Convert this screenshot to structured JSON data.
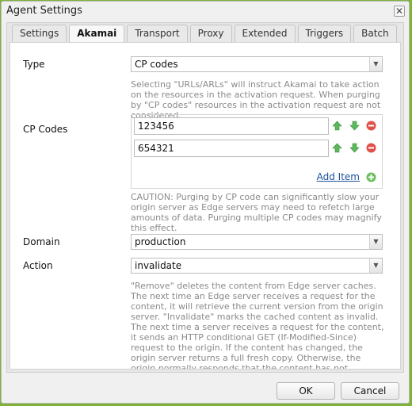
{
  "window": {
    "title": "Agent Settings",
    "close_icon": "close-icon"
  },
  "tabs": [
    {
      "label": "Settings",
      "active": false
    },
    {
      "label": "Akamai",
      "active": true
    },
    {
      "label": "Transport",
      "active": false
    },
    {
      "label": "Proxy",
      "active": false
    },
    {
      "label": "Extended",
      "active": false
    },
    {
      "label": "Triggers",
      "active": false
    },
    {
      "label": "Batch",
      "active": false
    }
  ],
  "form": {
    "type": {
      "label": "Type",
      "value": "CP codes",
      "help": "Selecting \"URLs/ARLs\" will instruct Akamai to take action on the resources in the activation request. When purging by \"CP codes\" resources in the activation request are not considered."
    },
    "cp_codes": {
      "label": "CP Codes",
      "items": [
        "123456",
        "654321"
      ],
      "add_label": "Add Item",
      "help": "CAUTION: Purging by CP code can significantly slow your origin server as Edge servers may need to refetch large amounts of data. Purging multiple CP codes may magnify this effect."
    },
    "domain": {
      "label": "Domain",
      "value": "production"
    },
    "action": {
      "label": "Action",
      "value": "invalidate",
      "help": "\"Remove\" deletes the content from Edge server caches. The next time an Edge server receives a request for the content, it will retrieve the current version from the origin server. \"Invalidate\" marks the cached content as invalid. The next time a server receives a request for the content, it sends an HTTP conditional GET (If-Modified-Since) request to the origin. If the content has changed, the origin server returns a full fresh copy. Otherwise, the origin normally responds that the content has not changed, and the Edge server can serve the already-cached content."
    }
  },
  "buttons": {
    "ok": "OK",
    "cancel": "Cancel"
  },
  "colors": {
    "up_arrow": "#5cb85c",
    "down_arrow": "#5cb85c",
    "remove": "#e2504c",
    "add": "#6cbf5a",
    "link": "#1a4f9c"
  }
}
